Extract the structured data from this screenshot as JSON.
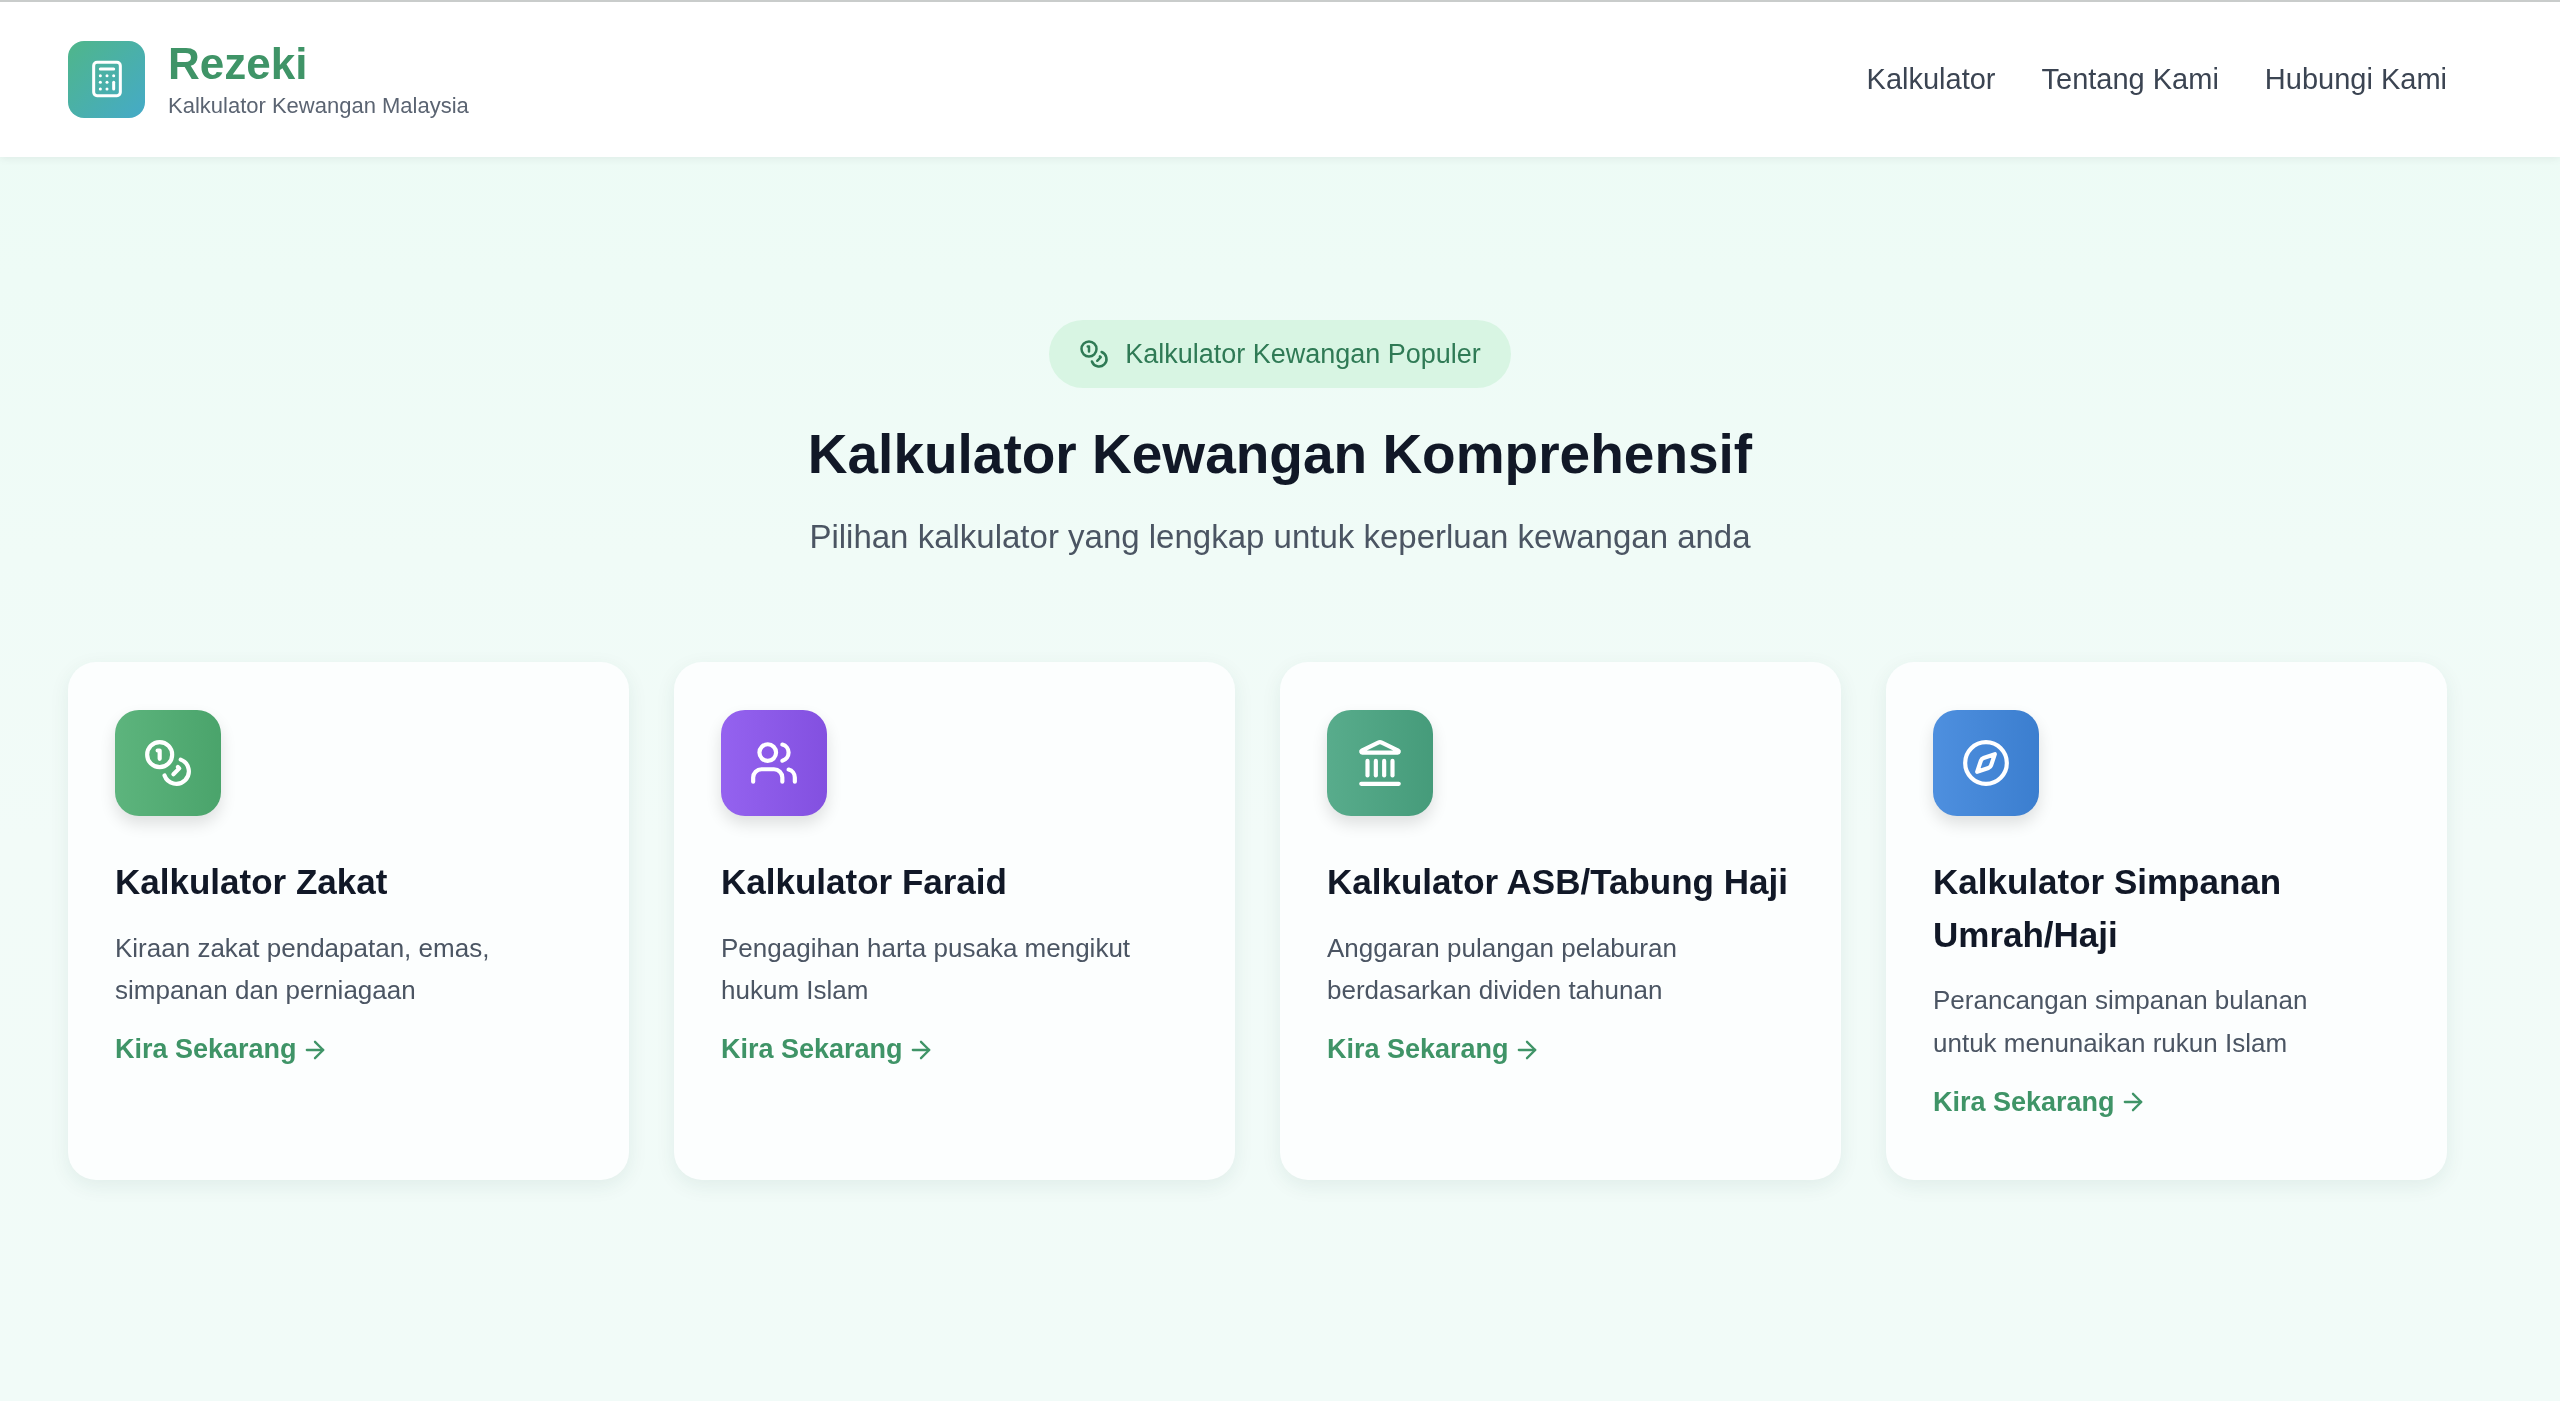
{
  "header": {
    "brand": "Rezeki",
    "tagline": "Kalkulator Kewangan Malaysia",
    "nav": [
      {
        "label": "Kalkulator"
      },
      {
        "label": "Tentang Kami"
      },
      {
        "label": "Hubungi Kami"
      }
    ]
  },
  "hero": {
    "badge": "Kalkulator Kewangan Populer",
    "title": "Kalkulator Kewangan Komprehensif",
    "subtitle": "Pilihan kalkulator yang lengkap untuk keperluan kewangan anda"
  },
  "cards": [
    {
      "kind": "coins",
      "color": "#4fae72",
      "title": "Kalkulator Zakat",
      "description": "Kiraan zakat pendapatan, emas, simpanan dan perniagaan",
      "link": "Kira Sekarang"
    },
    {
      "kind": "users",
      "color": "#8b55ee",
      "title": "Kalkulator Faraid",
      "description": "Pengagihan harta pusaka mengikut hukum Islam",
      "link": "Kira Sekarang"
    },
    {
      "kind": "bank",
      "color": "#4aa582",
      "title": "Kalkulator ASB/Tabung Haji",
      "description": "Anggaran pulangan pelaburan berdasarkan dividen tahunan",
      "link": "Kira Sekarang"
    },
    {
      "kind": "compass",
      "color": "#3f86dc",
      "title": "Kalkulator Simpanan Umrah/Haji",
      "description": "Perancangan simpanan bulanan untuk menunaikan rukun Islam",
      "link": "Kira Sekarang"
    }
  ]
}
